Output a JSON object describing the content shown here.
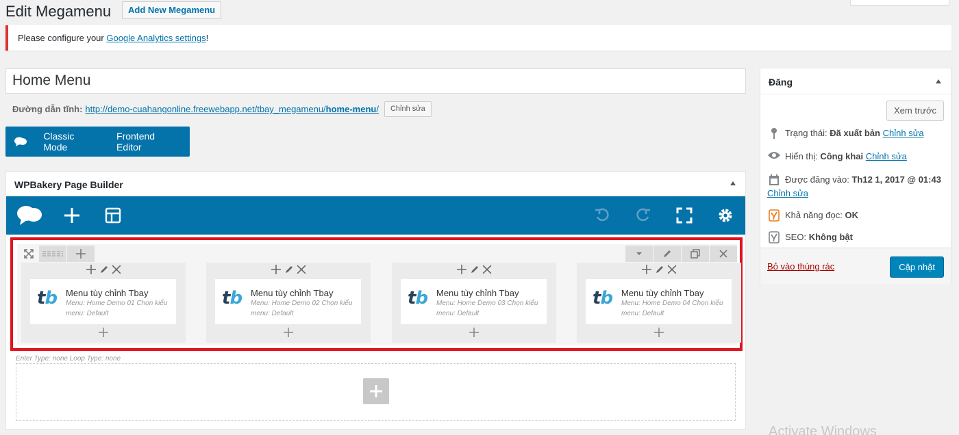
{
  "header": {
    "title": "Edit Megamenu",
    "add_new_label": "Add New Megamenu"
  },
  "notice": {
    "prefix": "Please configure your ",
    "link_text": "Google Analytics settings",
    "suffix": "!"
  },
  "post": {
    "title": "Home Menu",
    "permalink_label": "Đường dẫn tĩnh:",
    "permalink_base": "http://demo-cuahangonline.freewebapp.net/tbay_megamenu/",
    "permalink_slug": "home-menu",
    "permalink_trailing": "/",
    "edit_slug_label": "Chỉnh sửa"
  },
  "vc_switch": {
    "classic_label": "Classic Mode",
    "frontend_label": "Frontend Editor"
  },
  "wpb": {
    "title": "WPBakery Page Builder",
    "columns": [
      {
        "name": "Menu tùy chỉnh Tbay",
        "meta": "Menu: Home Demo 01  Chọn kiểu menu: Default"
      },
      {
        "name": "Menu tùy chỉnh Tbay",
        "meta": "Menu: Home Demo 02  Chọn kiểu menu: Default"
      },
      {
        "name": "Menu tùy chỉnh Tbay",
        "meta": "Menu: Home Demo 03  Chọn kiểu menu: Default"
      },
      {
        "name": "Menu tùy chỉnh Tbay",
        "meta": "Menu: Home Demo 04  Chọn kiểu menu: Default"
      }
    ],
    "row_meta": "Enter Type: none  Loop Type: none",
    "highlight_color": "#e0131e",
    "nav_color": "#0473aa"
  },
  "publish": {
    "title": "Đăng",
    "preview_label": "Xem trước",
    "status_label": "Trạng thái:",
    "status_value": "Đã xuất bản",
    "visibility_label": "Hiển thị:",
    "visibility_value": "Công khai",
    "published_label": "Được đăng vào:",
    "published_value": "Th12 1, 2017 @ 01:43",
    "edit_label": "Chỉnh sửa",
    "readability_label": "Khả năng đọc:",
    "readability_value": "OK",
    "seo_label": "SEO:",
    "seo_value": "Không bật",
    "trash_label": "Bỏ vào thùng rác",
    "update_label": "Cập nhật"
  },
  "watermark": "Activate Windows"
}
